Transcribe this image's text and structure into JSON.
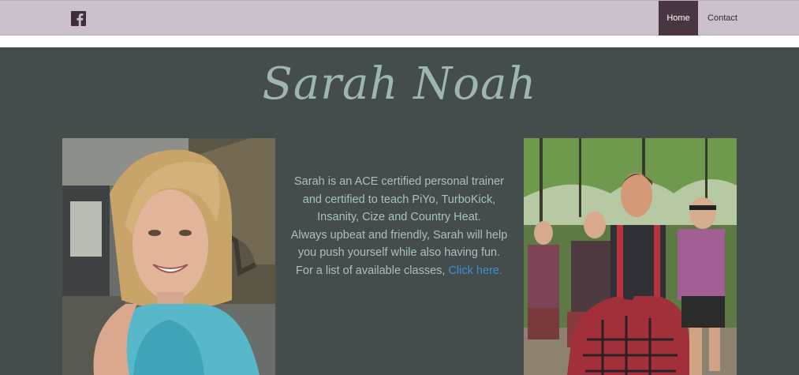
{
  "header": {
    "social_icon": "facebook-icon",
    "nav": [
      {
        "label": "Home",
        "active": true
      },
      {
        "label": "Contact",
        "active": false
      }
    ]
  },
  "hero": {
    "title": "Sarah Noah",
    "bio": {
      "line1": "Sarah is an ACE certified personal trainer and certified to teach PiYo, TurboKick, Insanity, Cize and Country Heat.",
      "line2": "Always upbeat and friendly, Sarah will help you push yourself while also having fun.",
      "line3_prefix": "For a list of available classes, ",
      "link": "Click here."
    }
  },
  "colors": {
    "topbar": "#cbc1cd",
    "nav_active": "#4a3542",
    "hero_bg": "#444d4c",
    "title": "#9db6b3",
    "body_text": "#a9c0be",
    "link": "#3e8fd6"
  }
}
